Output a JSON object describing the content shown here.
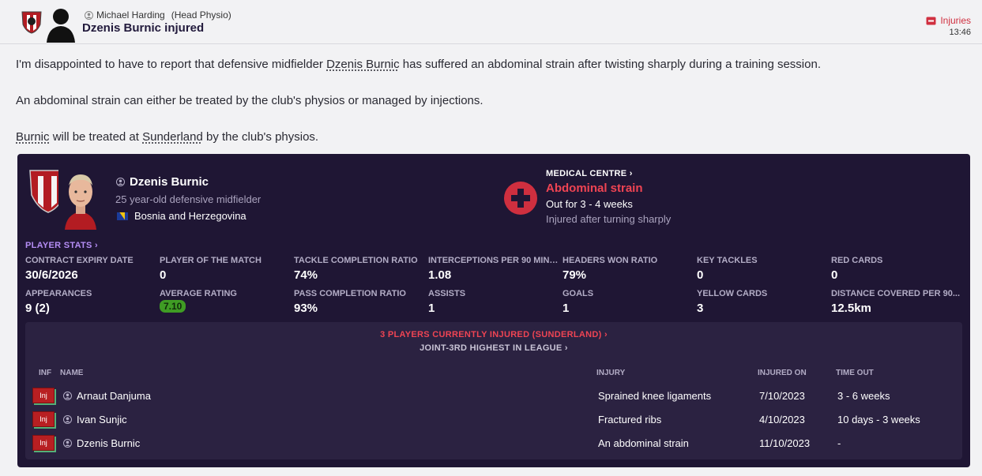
{
  "header": {
    "sender_name": "Michael Harding",
    "sender_role": "(Head Physio)",
    "subject": "Dzenis Burnic injured",
    "category": "Injuries",
    "time": "13:46"
  },
  "body": {
    "p1_before": "I'm disappointed to have to report that defensive midfielder ",
    "p1_link": "Dzenis Burnic",
    "p1_after": " has suffered an abdominal strain after twisting sharply during a training session.",
    "p2": "An abdominal strain can either be treated by the club's physios or managed by injections.",
    "p3_link1": "Burnic",
    "p3_mid": " will be treated at ",
    "p3_link2": "Sunderland",
    "p3_after": " by the club's physios."
  },
  "player": {
    "name": "Dzenis Burnic",
    "description": "25 year-old defensive midfielder",
    "nationality": "Bosnia and Herzegovina"
  },
  "medical": {
    "link": "MEDICAL CENTRE ›",
    "injury": "Abdominal strain",
    "out_for": "Out for 3 - 4 weeks",
    "cause": "Injured after turning sharply"
  },
  "stats_link": "PLAYER STATS ›",
  "stats": [
    {
      "label": "CONTRACT EXPIRY DATE",
      "value": "30/6/2026"
    },
    {
      "label": "PLAYER OF THE MATCH",
      "value": "0"
    },
    {
      "label": "TACKLE COMPLETION RATIO",
      "value": "74%"
    },
    {
      "label": "INTERCEPTIONS PER 90 MINU...",
      "value": "1.08"
    },
    {
      "label": "HEADERS WON RATIO",
      "value": "79%"
    },
    {
      "label": "KEY TACKLES",
      "value": "0"
    },
    {
      "label": "RED CARDS",
      "value": "0"
    },
    {
      "label": "APPEARANCES",
      "value": "9 (2)"
    },
    {
      "label": "AVERAGE RATING",
      "value": "7.10"
    },
    {
      "label": "PASS COMPLETION RATIO",
      "value": "93%"
    },
    {
      "label": "ASSISTS",
      "value": "1"
    },
    {
      "label": "GOALS",
      "value": "1"
    },
    {
      "label": "YELLOW CARDS",
      "value": "3"
    },
    {
      "label": "DISTANCE COVERED PER 90...",
      "value": "12.5km"
    }
  ],
  "injured_list": {
    "count_link": "3 PLAYERS CURRENTLY INJURED (SUNDERLAND) ›",
    "rank_link": "JOINT-3RD HIGHEST IN LEAGUE ›",
    "columns": {
      "inf": "INF",
      "name": "NAME",
      "injury": "INJURY",
      "injured_on": "INJURED ON",
      "time_out": "TIME OUT"
    },
    "rows": [
      {
        "tag": "Inj",
        "name": "Arnaut Danjuma",
        "injury": "Sprained knee ligaments",
        "injured_on": "7/10/2023",
        "time_out": "3 - 6 weeks"
      },
      {
        "tag": "Inj",
        "name": "Ivan Sunjic",
        "injury": "Fractured ribs",
        "injured_on": "4/10/2023",
        "time_out": "10 days - 3 weeks"
      },
      {
        "tag": "Inj",
        "name": "Dzenis Burnic",
        "injury": "An abdominal strain",
        "injured_on": "11/10/2023",
        "time_out": "-"
      }
    ]
  }
}
